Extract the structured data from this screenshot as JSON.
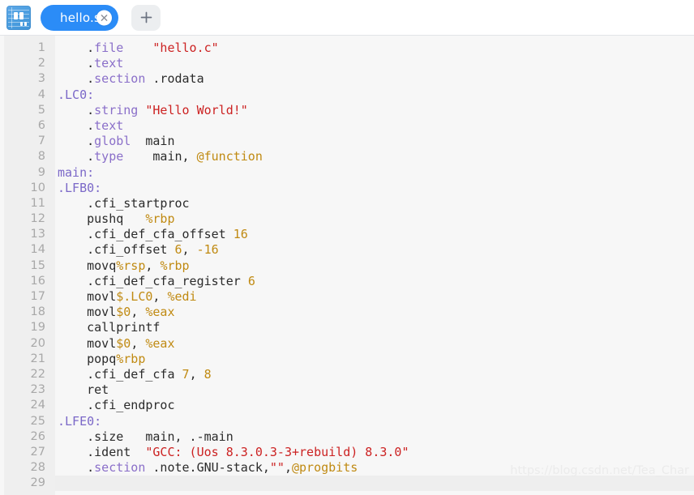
{
  "window": {
    "app_icon": "notebook-icon"
  },
  "tabbar": {
    "tabs": [
      {
        "label": "hello.s",
        "close_icon": "close-icon",
        "active": true
      }
    ],
    "new_tab_label": "+",
    "new_tab_icon": "plus-icon"
  },
  "editor": {
    "language": "assembly",
    "total_lines": 29,
    "active_line": 29,
    "lines": [
      {
        "n": "1",
        "tokens": [
          {
            "t": "plain",
            "v": "    ."
          },
          {
            "t": "dir",
            "v": "file"
          },
          {
            "t": "plain",
            "v": "    "
          },
          {
            "t": "str",
            "v": "\"hello.c\""
          }
        ]
      },
      {
        "n": "2",
        "tokens": [
          {
            "t": "plain",
            "v": "    ."
          },
          {
            "t": "dir",
            "v": "text"
          }
        ]
      },
      {
        "n": "3",
        "tokens": [
          {
            "t": "plain",
            "v": "    ."
          },
          {
            "t": "dir",
            "v": "section"
          },
          {
            "t": "plain",
            "v": " .rodata"
          }
        ]
      },
      {
        "n": "4",
        "tokens": [
          {
            "t": "label",
            "v": ".LC0:"
          }
        ]
      },
      {
        "n": "5",
        "tokens": [
          {
            "t": "plain",
            "v": "    ."
          },
          {
            "t": "dir",
            "v": "string"
          },
          {
            "t": "plain",
            "v": " "
          },
          {
            "t": "str",
            "v": "\"Hello World!\""
          }
        ]
      },
      {
        "n": "6",
        "tokens": [
          {
            "t": "plain",
            "v": "    ."
          },
          {
            "t": "dir",
            "v": "text"
          }
        ]
      },
      {
        "n": "7",
        "tokens": [
          {
            "t": "plain",
            "v": "    ."
          },
          {
            "t": "dir",
            "v": "globl"
          },
          {
            "t": "plain",
            "v": "  main"
          }
        ]
      },
      {
        "n": "8",
        "tokens": [
          {
            "t": "plain",
            "v": "    ."
          },
          {
            "t": "dir",
            "v": "type"
          },
          {
            "t": "plain",
            "v": "    main, "
          },
          {
            "t": "at",
            "v": "@function"
          }
        ]
      },
      {
        "n": "9",
        "tokens": [
          {
            "t": "label",
            "v": "main:"
          }
        ]
      },
      {
        "n": "10",
        "tokens": [
          {
            "t": "label",
            "v": ".LFB0:"
          }
        ]
      },
      {
        "n": "11",
        "tokens": [
          {
            "t": "plain",
            "v": "    .cfi_startproc"
          }
        ]
      },
      {
        "n": "12",
        "tokens": [
          {
            "t": "plain",
            "v": "    pushq   "
          },
          {
            "t": "reg",
            "v": "%rbp"
          }
        ]
      },
      {
        "n": "13",
        "tokens": [
          {
            "t": "plain",
            "v": "    .cfi_def_cfa_offset "
          },
          {
            "t": "num",
            "v": "16"
          }
        ]
      },
      {
        "n": "14",
        "tokens": [
          {
            "t": "plain",
            "v": "    .cfi_offset "
          },
          {
            "t": "num",
            "v": "6"
          },
          {
            "t": "plain",
            "v": ", "
          },
          {
            "t": "num",
            "v": "-16"
          }
        ]
      },
      {
        "n": "15",
        "tokens": [
          {
            "t": "plain",
            "v": "    movq"
          },
          {
            "t": "reg",
            "v": "%rsp"
          },
          {
            "t": "plain",
            "v": ", "
          },
          {
            "t": "reg",
            "v": "%rbp"
          }
        ]
      },
      {
        "n": "16",
        "tokens": [
          {
            "t": "plain",
            "v": "    .cfi_def_cfa_register "
          },
          {
            "t": "num",
            "v": "6"
          }
        ]
      },
      {
        "n": "17",
        "tokens": [
          {
            "t": "plain",
            "v": "    movl"
          },
          {
            "t": "num",
            "v": "$.LC0"
          },
          {
            "t": "plain",
            "v": ", "
          },
          {
            "t": "reg",
            "v": "%edi"
          }
        ]
      },
      {
        "n": "18",
        "tokens": [
          {
            "t": "plain",
            "v": "    movl"
          },
          {
            "t": "num",
            "v": "$0"
          },
          {
            "t": "plain",
            "v": ", "
          },
          {
            "t": "reg",
            "v": "%eax"
          }
        ]
      },
      {
        "n": "19",
        "tokens": [
          {
            "t": "plain",
            "v": "    callprintf"
          }
        ]
      },
      {
        "n": "20",
        "tokens": [
          {
            "t": "plain",
            "v": "    movl"
          },
          {
            "t": "num",
            "v": "$0"
          },
          {
            "t": "plain",
            "v": ", "
          },
          {
            "t": "reg",
            "v": "%eax"
          }
        ]
      },
      {
        "n": "21",
        "tokens": [
          {
            "t": "plain",
            "v": "    popq"
          },
          {
            "t": "reg",
            "v": "%rbp"
          }
        ]
      },
      {
        "n": "22",
        "tokens": [
          {
            "t": "plain",
            "v": "    .cfi_def_cfa "
          },
          {
            "t": "num",
            "v": "7"
          },
          {
            "t": "plain",
            "v": ", "
          },
          {
            "t": "num",
            "v": "8"
          }
        ]
      },
      {
        "n": "23",
        "tokens": [
          {
            "t": "plain",
            "v": "    ret"
          }
        ]
      },
      {
        "n": "24",
        "tokens": [
          {
            "t": "plain",
            "v": "    .cfi_endproc"
          }
        ]
      },
      {
        "n": "25",
        "tokens": [
          {
            "t": "label",
            "v": ".LFE0:"
          }
        ]
      },
      {
        "n": "26",
        "tokens": [
          {
            "t": "plain",
            "v": "    .size   main, .-main"
          }
        ]
      },
      {
        "n": "27",
        "tokens": [
          {
            "t": "plain",
            "v": "    .ident  "
          },
          {
            "t": "str",
            "v": "\"GCC: (Uos 8.3.0.3-3+rebuild) 8.3.0\""
          }
        ]
      },
      {
        "n": "28",
        "tokens": [
          {
            "t": "plain",
            "v": "    ."
          },
          {
            "t": "dir",
            "v": "section"
          },
          {
            "t": "plain",
            "v": " .note.GNU-stack,"
          },
          {
            "t": "str",
            "v": "\"\""
          },
          {
            "t": "plain",
            "v": ","
          },
          {
            "t": "at",
            "v": "@progbits"
          }
        ]
      },
      {
        "n": "29",
        "tokens": []
      }
    ]
  },
  "watermark": {
    "text": "https://blog.csdn.net/Tea_Char"
  },
  "colors": {
    "tab_active": "#2b8cf7",
    "gutter_bg": "#efefef",
    "code_bg": "#f7f7f7",
    "directive": "#8a6fc9",
    "label": "#7b68c8",
    "string": "#cc2222",
    "number": "#c08a12",
    "register": "#c08a12",
    "plain_text": "#2b2b2b",
    "line_number": "#a8a8a8"
  }
}
